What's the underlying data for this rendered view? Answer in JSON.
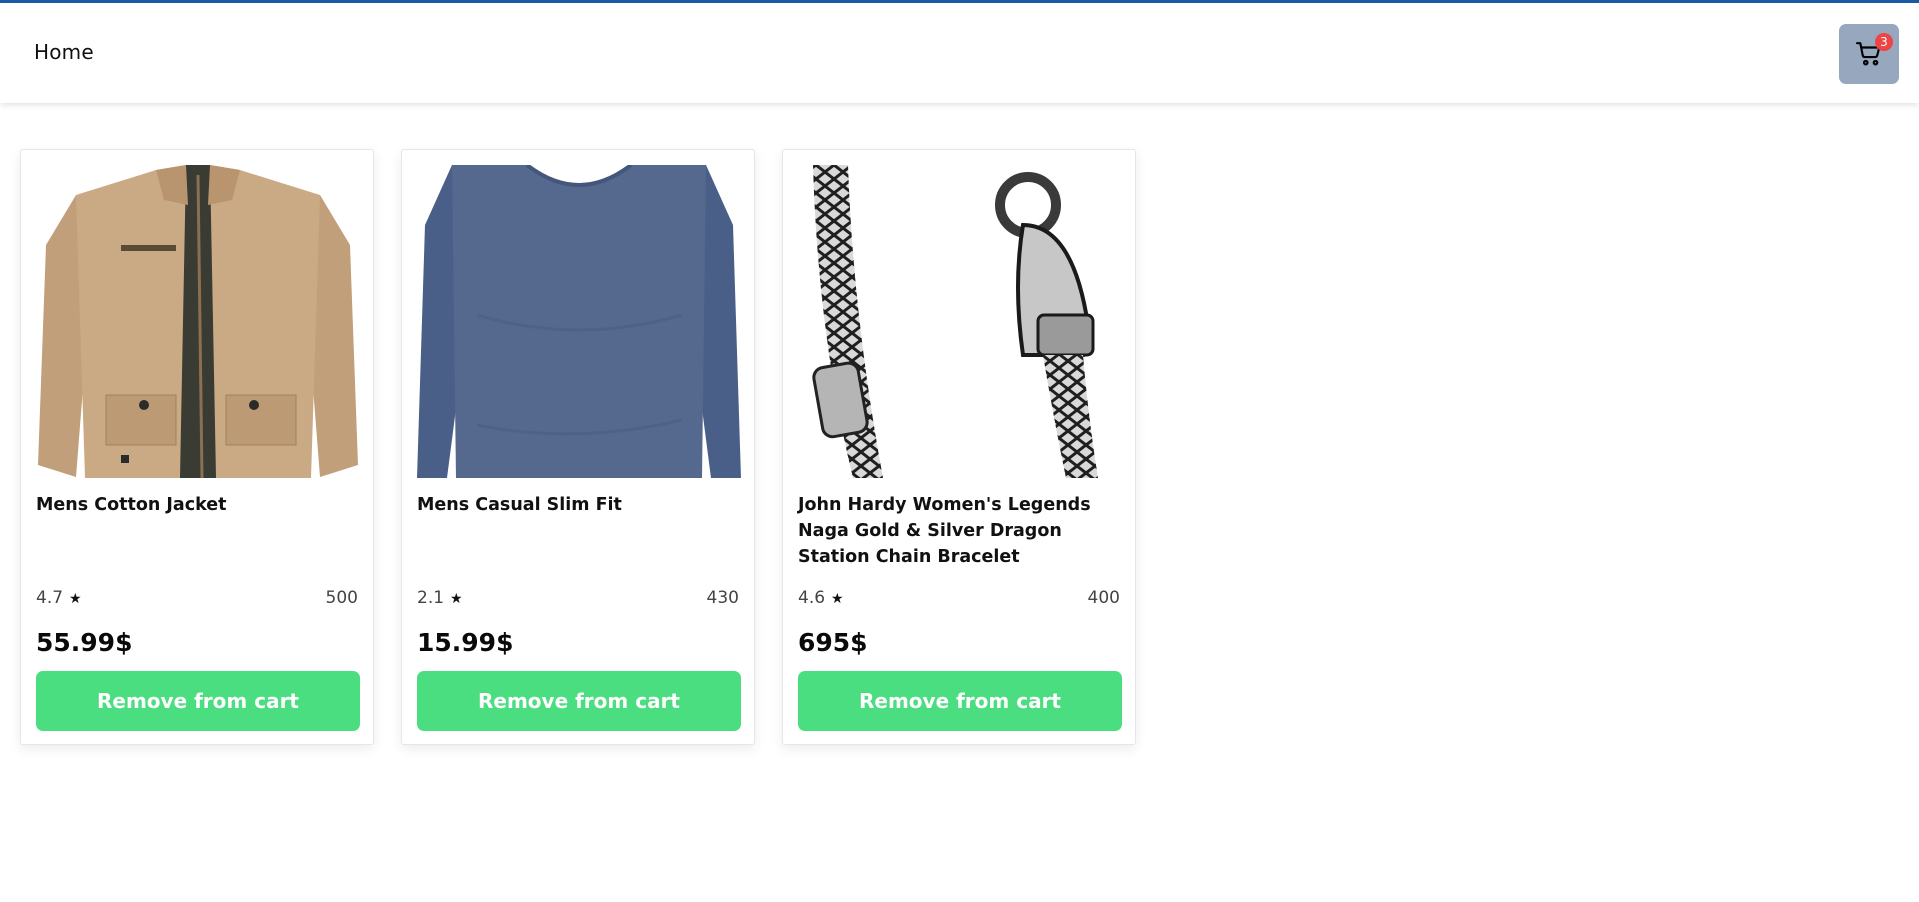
{
  "header": {
    "home_label": "Home",
    "cart_count": "3",
    "cart_icon": "shopping-cart-icon",
    "accent_color": "#1d5ba8",
    "cart_button_color": "#97a7bd",
    "badge_color": "#ef4444"
  },
  "products": [
    {
      "title": "Mens Cotton Jacket",
      "rating": "4.7",
      "count": "500",
      "price": "55.99$",
      "button_label": "Remove from cart",
      "image": "jacket"
    },
    {
      "title": "Mens Casual Slim Fit",
      "rating": "2.1",
      "count": "430",
      "price": "15.99$",
      "button_label": "Remove from cart",
      "image": "tshirt"
    },
    {
      "title": "John Hardy Women's Legends Naga Gold & Silver Dragon Station Chain Bracelet",
      "rating": "4.6",
      "count": "400",
      "price": "695$",
      "button_label": "Remove from cart",
      "image": "bracelet"
    }
  ],
  "button_color": "#4ade80"
}
